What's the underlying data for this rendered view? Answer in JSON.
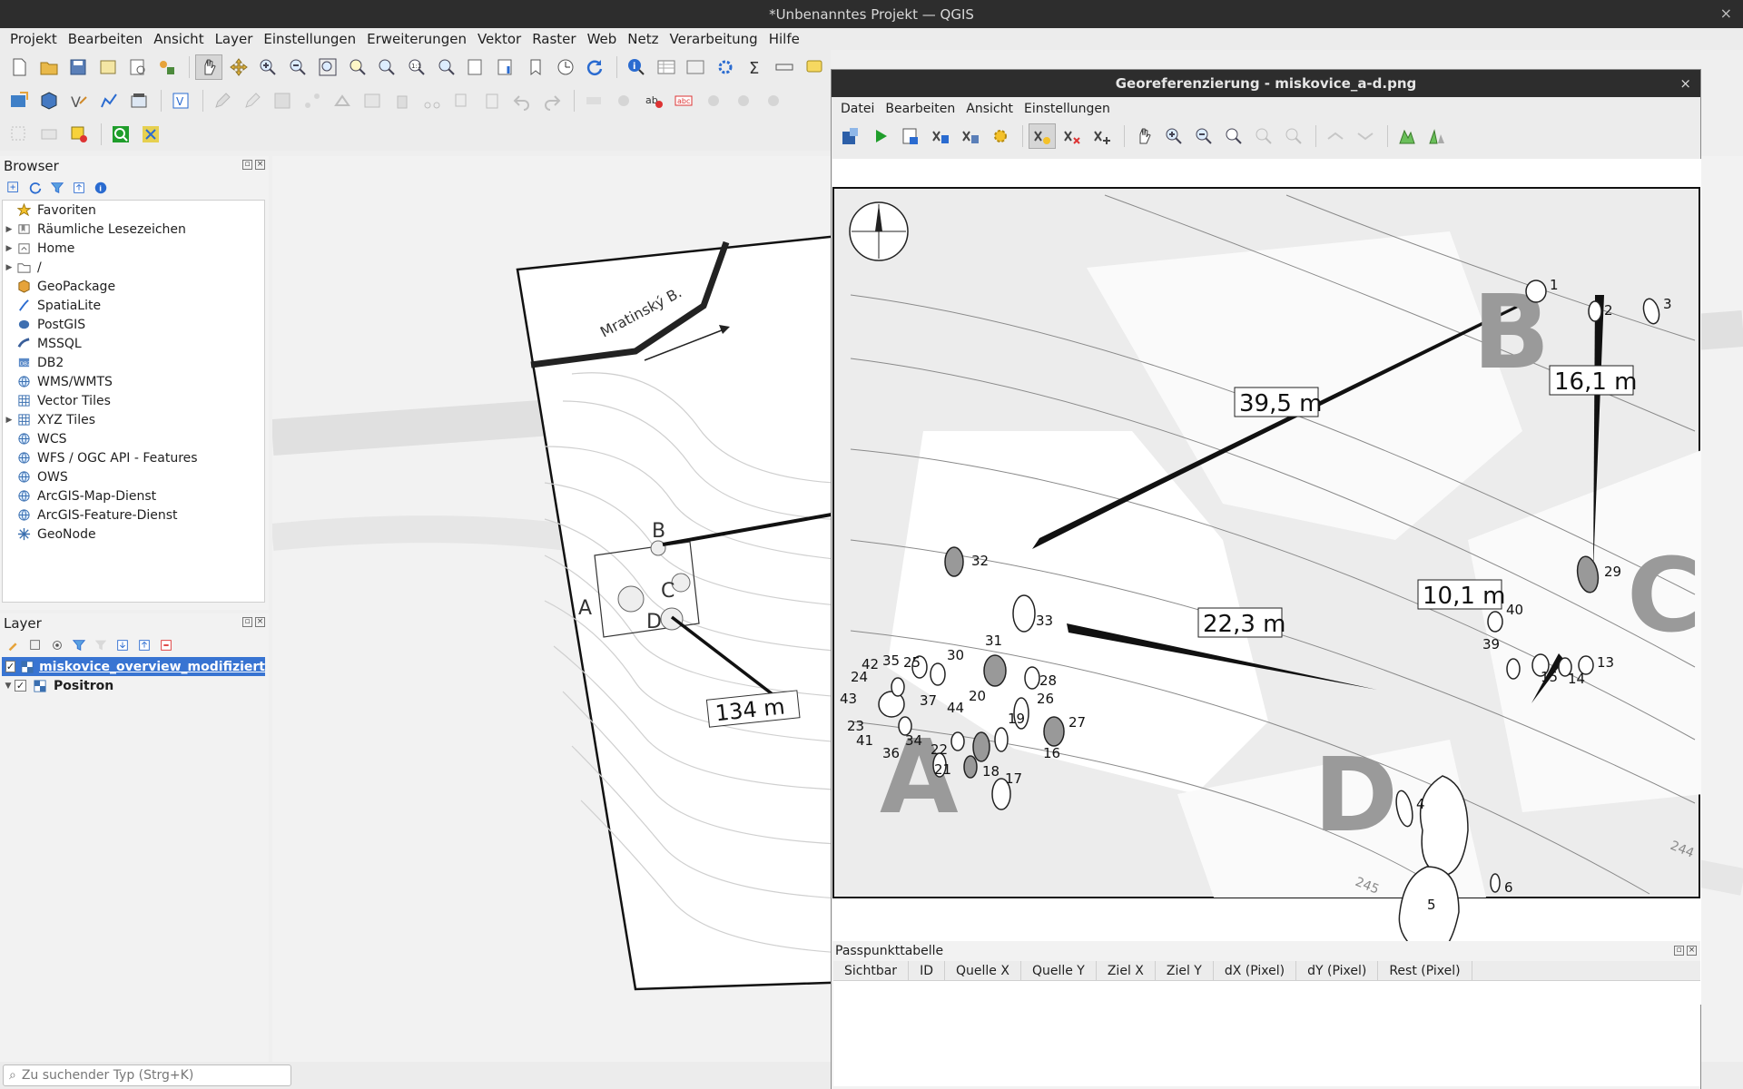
{
  "window": {
    "title": "*Unbenanntes Projekt — QGIS",
    "close": "×"
  },
  "menubar": [
    "Projekt",
    "Bearbeiten",
    "Ansicht",
    "Layer",
    "Einstellungen",
    "Erweiterungen",
    "Vektor",
    "Raster",
    "Web",
    "Netz",
    "Verarbeitung",
    "Hilfe"
  ],
  "browser": {
    "title": "Browser",
    "items": [
      {
        "label": "Favoriten",
        "icon": "star-icon",
        "expand": ""
      },
      {
        "label": "Räumliche Lesezeichen",
        "icon": "bookmark-icon",
        "expand": "▶"
      },
      {
        "label": "Home",
        "icon": "home-folder-icon",
        "expand": "▶"
      },
      {
        "label": "/",
        "icon": "folder-icon",
        "expand": "▶"
      },
      {
        "label": "GeoPackage",
        "icon": "geopackage-icon",
        "expand": ""
      },
      {
        "label": "SpatiaLite",
        "icon": "spatialite-icon",
        "expand": ""
      },
      {
        "label": "PostGIS",
        "icon": "postgis-icon",
        "expand": ""
      },
      {
        "label": "MSSQL",
        "icon": "mssql-icon",
        "expand": ""
      },
      {
        "label": "DB2",
        "icon": "db2-icon",
        "expand": ""
      },
      {
        "label": "WMS/WMTS",
        "icon": "globe-icon",
        "expand": ""
      },
      {
        "label": "Vector Tiles",
        "icon": "grid-icon",
        "expand": ""
      },
      {
        "label": "XYZ Tiles",
        "icon": "grid-icon",
        "expand": "▶"
      },
      {
        "label": "WCS",
        "icon": "globe-icon",
        "expand": ""
      },
      {
        "label": "WFS / OGC API - Features",
        "icon": "globe-icon",
        "expand": ""
      },
      {
        "label": "OWS",
        "icon": "globe-icon",
        "expand": ""
      },
      {
        "label": "ArcGIS-Map-Dienst",
        "icon": "globe-icon",
        "expand": ""
      },
      {
        "label": "ArcGIS-Feature-Dienst",
        "icon": "globe-icon",
        "expand": ""
      },
      {
        "label": "GeoNode",
        "icon": "geonode-icon",
        "expand": ""
      }
    ]
  },
  "layers": {
    "title": "Layer",
    "items": [
      {
        "label": "miskovice_overview_modifiziert",
        "checked": "✓",
        "expand": "",
        "selected": true
      },
      {
        "label": "Positron",
        "checked": "✓",
        "expand": "▼",
        "selected": false
      }
    ]
  },
  "map": {
    "road_label": "Mratinský B.",
    "labels": [
      "A",
      "B",
      "C",
      "D"
    ],
    "distance": "134 m"
  },
  "status": {
    "locator_placeholder": "Zu suchender Typ (Strg+K)"
  },
  "georef": {
    "title": "Georeferenzierung - miskovice_a-d.png",
    "close": "×",
    "menu": [
      "Datei",
      "Bearbeiten",
      "Ansicht",
      "Einstellungen"
    ],
    "big_labels": [
      "A",
      "B",
      "C",
      "D"
    ],
    "distances": [
      "39,5 m",
      "16,1 m",
      "10,1 m",
      "22,3 m"
    ],
    "contours": [
      "244",
      "245"
    ],
    "feature_numbers": [
      "1",
      "2",
      "3",
      "4",
      "5",
      "6",
      "13",
      "14",
      "15",
      "16",
      "17",
      "18",
      "19",
      "20",
      "21",
      "22",
      "23",
      "24",
      "25",
      "26",
      "27",
      "28",
      "29",
      "30",
      "31",
      "32",
      "33",
      "34",
      "35",
      "36",
      "37",
      "39",
      "40",
      "41",
      "42",
      "43",
      "44"
    ]
  },
  "gcp": {
    "title": "Passpunkttabelle",
    "columns": [
      "Sichtbar",
      "ID",
      "Quelle X",
      "Quelle Y",
      "Ziel X",
      "Ziel Y",
      "dX (Pixel)",
      "dY (Pixel)",
      "Rest (Pixel)"
    ]
  },
  "colors": {
    "selection": "#3874d2",
    "titlebar": "#2d2d2d",
    "accent_green": "#1f9d2b"
  }
}
